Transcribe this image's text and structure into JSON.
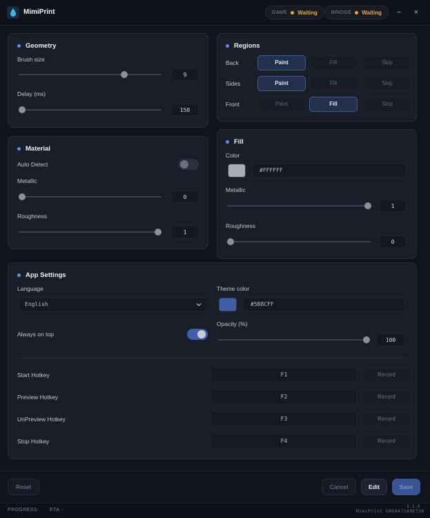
{
  "titlebar": {
    "title": "MimiPrint",
    "game_label": "GAME",
    "game_status": "Waiting",
    "bridge_label": "BRIDGE",
    "bridge_status": "Waiting",
    "minimize_glyph": "−",
    "close_glyph": "×"
  },
  "geometry": {
    "title": "Geometry",
    "brush_label": "Brush size",
    "brush_value": "9",
    "brush_level": 0.75,
    "delay_label": "Delay (ms)",
    "delay_value": "150",
    "delay_level": 0.0
  },
  "regions": {
    "title": "Regions",
    "options": [
      "Paint",
      "Fill",
      "Skip"
    ],
    "rows": [
      {
        "label": "Back",
        "selected": "Paint"
      },
      {
        "label": "Sides",
        "selected": "Paint"
      },
      {
        "label": "Front",
        "selected": "Fill"
      }
    ]
  },
  "material": {
    "title": "Material",
    "auto_detect_label": "Auto Detect",
    "auto_detect_on": false,
    "metallic_label": "Metallic",
    "metallic_value": "0",
    "metallic_level": 0.0,
    "roughness_label": "Roughness",
    "roughness_value": "1",
    "roughness_level": 1.0
  },
  "fill": {
    "title": "Fill",
    "color_label": "Color",
    "color_value": "#FFFFFF",
    "swatch_color": "#a9adb6",
    "metallic_label": "Metallic",
    "metallic_value": "1",
    "metallic_level": 1.0,
    "roughness_label": "Roughness",
    "roughness_value": "0",
    "roughness_level": 0.0
  },
  "app_settings": {
    "title": "App Settings",
    "language_label": "Language",
    "language_value": "English",
    "theme_label": "Theme color",
    "theme_value": "#5B8CFF",
    "theme_swatch": "#3f5da8",
    "always_on_top_label": "Always on top",
    "always_on_top_on": true,
    "opacity_label": "Opacity (%)",
    "opacity_value": "100",
    "opacity_level": 1.0,
    "record_label": "Record",
    "hotkeys": [
      {
        "label": "Start Hotkey",
        "key": "F1"
      },
      {
        "label": "Preview Hotkey",
        "key": "F2"
      },
      {
        "label": "UnPreview Hotkey",
        "key": "F3"
      },
      {
        "label": "Stop Hotkey",
        "key": "F4"
      }
    ]
  },
  "footer": {
    "reset_label": "Reset",
    "cancel_label": "Cancel",
    "edit_label": "Edit",
    "save_label": "Save"
  },
  "statusbar": {
    "progress_label": "PROGRESS",
    "progress_value": "-",
    "eta_label": "ETA",
    "eta_value": "-",
    "build_info": "MimiPrint UNS8471A9E736",
    "version_overlay": "3.1.0"
  },
  "colors": {
    "accent": "#5B8CFF",
    "status_waiting": "#f0a53a"
  }
}
